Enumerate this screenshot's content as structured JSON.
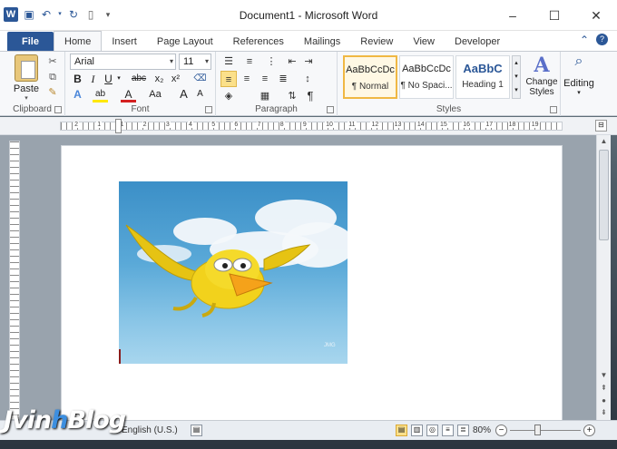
{
  "app": {
    "logo_letter": "W",
    "title": "Document1 - Microsoft Word"
  },
  "window_controls": {
    "minimize": "–",
    "maximize": "☐",
    "close": "✕"
  },
  "tabs": {
    "file": "File",
    "items": [
      "Home",
      "Insert",
      "Page Layout",
      "References",
      "Mailings",
      "Review",
      "View",
      "Developer"
    ]
  },
  "ribbon": {
    "clipboard": {
      "paste_label": "Paste",
      "group_label": "Clipboard"
    },
    "font": {
      "name": "Arial",
      "size": "11",
      "group_label": "Font",
      "buttons": {
        "bold": "B",
        "italic": "I",
        "underline": "U",
        "strike": "abc",
        "sub": "x₂",
        "sup": "x²",
        "grow": "A",
        "shrink": "A",
        "case": "Aa",
        "clear": "A",
        "color": "A",
        "highlight": "ab"
      }
    },
    "paragraph": {
      "group_label": "Paragraph",
      "pilcrow": "¶"
    },
    "styles": {
      "group_label": "Styles",
      "items": [
        {
          "preview": "AaBbCcDc",
          "name": "¶ Normal"
        },
        {
          "preview": "AaBbCcDc",
          "name": "¶ No Spaci..."
        },
        {
          "preview": "AaBbC",
          "name": "Heading 1"
        }
      ],
      "change_styles": "Change Styles"
    },
    "editing": {
      "label": "Editing"
    }
  },
  "ruler": {
    "numbers": [
      "2",
      "1",
      "1",
      "2",
      "3",
      "4",
      "5",
      "6",
      "7",
      "8",
      "9",
      "10",
      "11",
      "12",
      "13",
      "14",
      "15",
      "16",
      "17",
      "18",
      "19"
    ]
  },
  "status": {
    "language": "English (U.S.)",
    "zoom": "80%"
  },
  "picture": {
    "signature": "JMG"
  },
  "watermark": {
    "part1": "Jvin",
    "part2": "h",
    "part3": "Blog"
  },
  "colors": {
    "word_blue": "#2b5797",
    "selection": "#fbe08a",
    "sky": "#5aa9d8",
    "bird": "#f2d21c"
  }
}
